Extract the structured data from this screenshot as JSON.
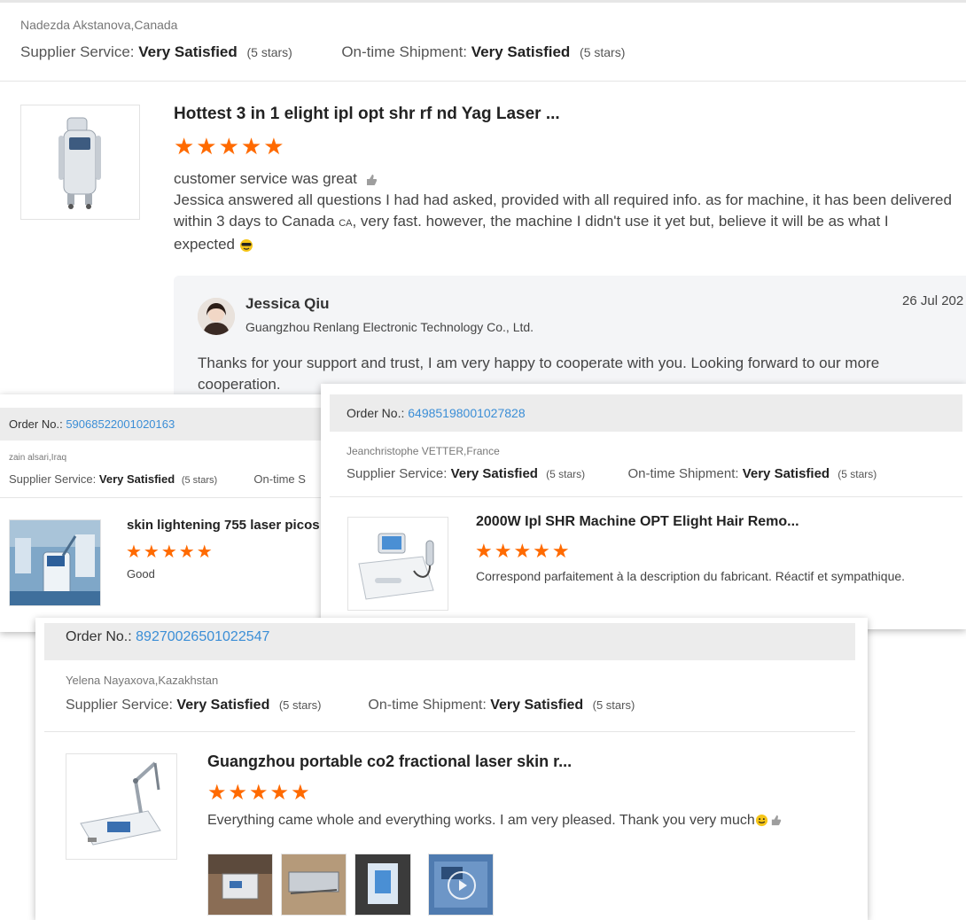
{
  "review1": {
    "reviewer": "Nadezda Akstanova,Canada",
    "supplier_label": "Supplier Service:",
    "supplier_value": "Very Satisfied",
    "supplier_stars": "(5 stars)",
    "shipment_label": "On-time Shipment:",
    "shipment_value": "Very Satisfied",
    "shipment_stars": "(5 stars)",
    "product_title": "Hottest 3 in 1 elight ipl opt shr rf nd Yag Laser ...",
    "rating": 5,
    "stars": "★★★★★",
    "comment_line1": "customer service was great",
    "comment_body_a": "Jessica answered all questions I had had asked, provided with all required info. as for machine, it has been delivered within 3 days to Canada",
    "country_code": "CA",
    "comment_body_b": ", very fast. however, the machine I didn't use it yet but, believe it will be as what I expected",
    "reply": {
      "name": "Jessica Qiu",
      "company": "Guangzhou Renlang Electronic Technology Co., Ltd.",
      "date": "26 Jul 202",
      "text": "Thanks for your support and trust, I am very happy to cooperate with you. Looking forward to our more cooperation."
    }
  },
  "review2": {
    "order_label": "Order No.:",
    "order_no": "59068522001020163",
    "reviewer": "zain alsari,Iraq",
    "supplier_label": "Supplier Service:",
    "supplier_value": "Very Satisfied",
    "supplier_stars": "(5 stars)",
    "shipment_label": "On-time S",
    "product_title": "skin lightening 755 laser picos",
    "rating": 5,
    "stars": "★★★★★",
    "comment": "Good"
  },
  "review3": {
    "order_label": "Order No.:",
    "order_no": "64985198001027828",
    "reviewer": "Jeanchristophe VETTER,France",
    "supplier_label": "Supplier Service:",
    "supplier_value": "Very Satisfied",
    "supplier_stars": "(5 stars)",
    "shipment_label": "On-time Shipment:",
    "shipment_value": "Very Satisfied",
    "shipment_stars": "(5 stars)",
    "product_title": "2000W Ipl SHR Machine OPT Elight Hair Remo...",
    "rating": 5,
    "stars": "★★★★★",
    "comment": "Correspond parfaitement à la description du fabricant. Réactif et sympathique."
  },
  "review4": {
    "order_label": "Order No.:",
    "order_no": "89270026501022547",
    "reviewer": "Yelena Nayaxova,Kazakhstan",
    "supplier_label": "Supplier Service:",
    "supplier_value": "Very Satisfied",
    "supplier_stars": "(5 stars)",
    "shipment_label": "On-time Shipment:",
    "shipment_value": "Very Satisfied",
    "shipment_stars": "(5 stars)",
    "product_title": "Guangzhou portable co2 fractional laser skin r...",
    "rating": 5,
    "stars": "★★★★★",
    "comment": "Everything came whole and everything works.  I am very pleased.  Thank you very much",
    "photo_count": 4
  },
  "colors": {
    "star": "#ff6a00",
    "link": "#3b8ed6",
    "order_bar": "#ececec",
    "reply_bg": "#f4f5f7"
  },
  "icons": [
    "thumbs-up-icon",
    "sunglasses-emoji-icon",
    "smile-emoji-icon",
    "play-icon",
    "star-icon"
  ]
}
